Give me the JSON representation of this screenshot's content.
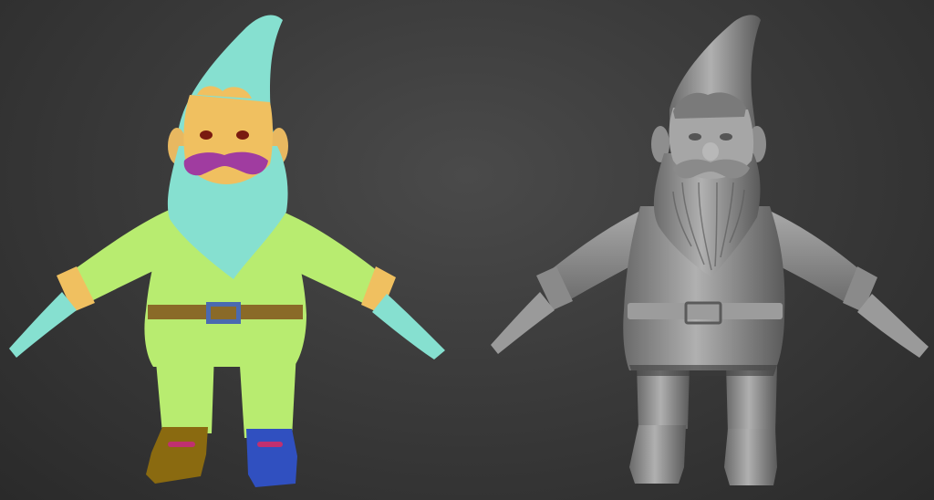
{
  "viewport": {
    "background_top": "#4a4a4a",
    "background_bottom": "#2a2a2a"
  },
  "models": [
    {
      "id": "segmented-gnome",
      "render_style": "flat color segmentation",
      "colors": {
        "hat_and_beard": "#86e0d0",
        "hands": "#86e0d0",
        "face": "#f0c060",
        "cheeks": "#e8b860",
        "mustache": "#a03ca0",
        "eyes": "#7a1a10",
        "body": "#b8ec70",
        "belt": "#8a6a28",
        "buckle": "#4a6ab0",
        "cuffs": "#f0c060",
        "left_boot": "#8a6a10",
        "right_boot": "#3050c0",
        "boot_marks": "#c03070"
      }
    },
    {
      "id": "sculpted-gnome",
      "render_style": "grey clay shading",
      "colors": {
        "base": "#8c8c8c",
        "highlight": "#bdbdbd",
        "shadow": "#4e4e4e"
      }
    }
  ]
}
